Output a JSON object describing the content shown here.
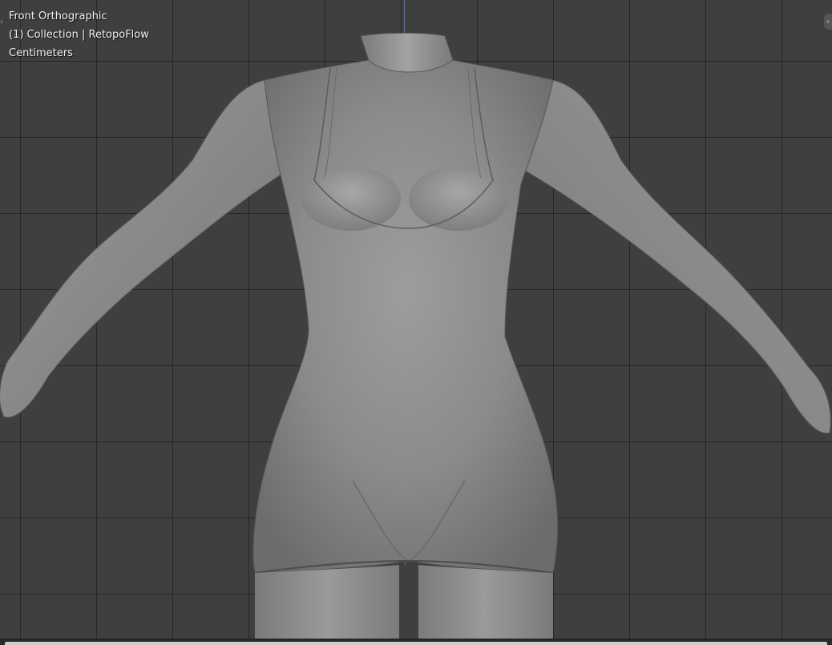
{
  "viewport": {
    "view_name": "Front Orthographic",
    "collection_label": "(1) Collection | RetopoFlow",
    "units_label": "Centimeters"
  },
  "icons": {
    "left_toggle": "chevron-right-icon",
    "right_toggle": "chevron-left-icon"
  },
  "colors": {
    "background": "#3f3f3f",
    "grid": "#2a2a2a",
    "axis": "#4b74b8",
    "model": "#8e8e8e"
  }
}
